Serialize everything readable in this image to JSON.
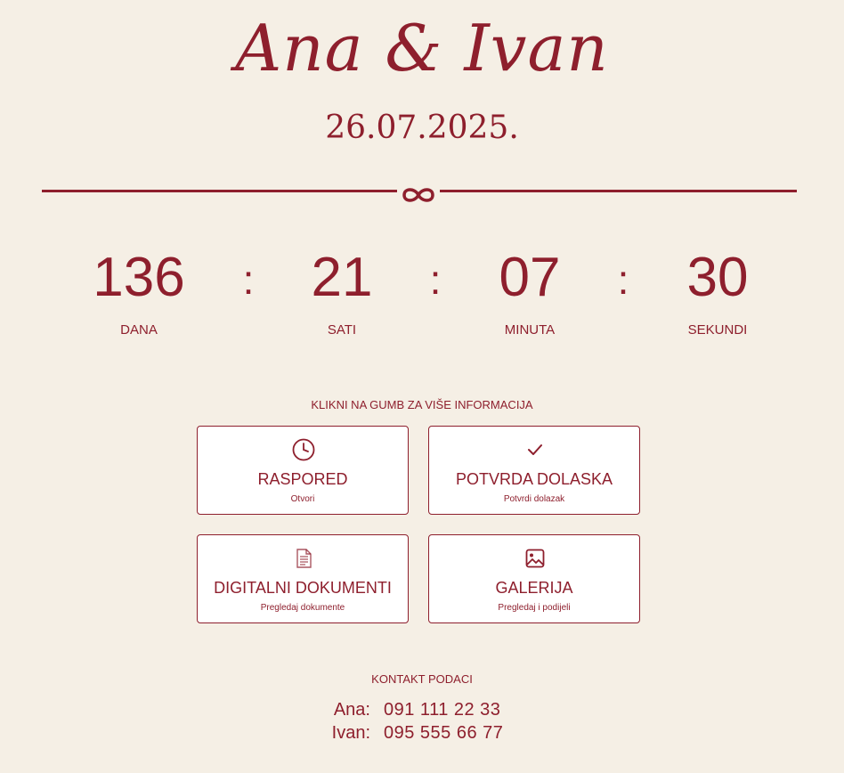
{
  "header": {
    "title": "Ana & Ivan",
    "date": "26.07.2025."
  },
  "countdown": {
    "separator": ":",
    "units": [
      {
        "value": "136",
        "label": "DANA"
      },
      {
        "value": "21",
        "label": "SATI"
      },
      {
        "value": "07",
        "label": "MINUTA"
      },
      {
        "value": "30",
        "label": "SEKUNDI"
      }
    ]
  },
  "info": {
    "label": "KLIKNI NA GUMB ZA VIŠE INFORMACIJA",
    "cards": [
      {
        "title": "RASPORED",
        "subtitle": "Otvori",
        "icon": "clock-icon"
      },
      {
        "title": "POTVRDA DOLASKA",
        "subtitle": "Potvrdi dolazak",
        "icon": "checkmark-icon"
      },
      {
        "title": "DIGITALNI DOKUMENTI",
        "subtitle": "Pregledaj dokumente",
        "icon": "document-icon"
      },
      {
        "title": "GALERIJA",
        "subtitle": "Pregledaj i podijeli",
        "icon": "image-icon"
      }
    ]
  },
  "contact": {
    "label": "KONTAKT PODACI",
    "people": [
      {
        "name": "Ana:",
        "phone": "091 111 22 33"
      },
      {
        "name": "Ivan:",
        "phone": "095 555 66 77"
      }
    ]
  },
  "colors": {
    "accent": "#8e1f2d",
    "background": "#f5efe5",
    "card": "#ffffff"
  }
}
